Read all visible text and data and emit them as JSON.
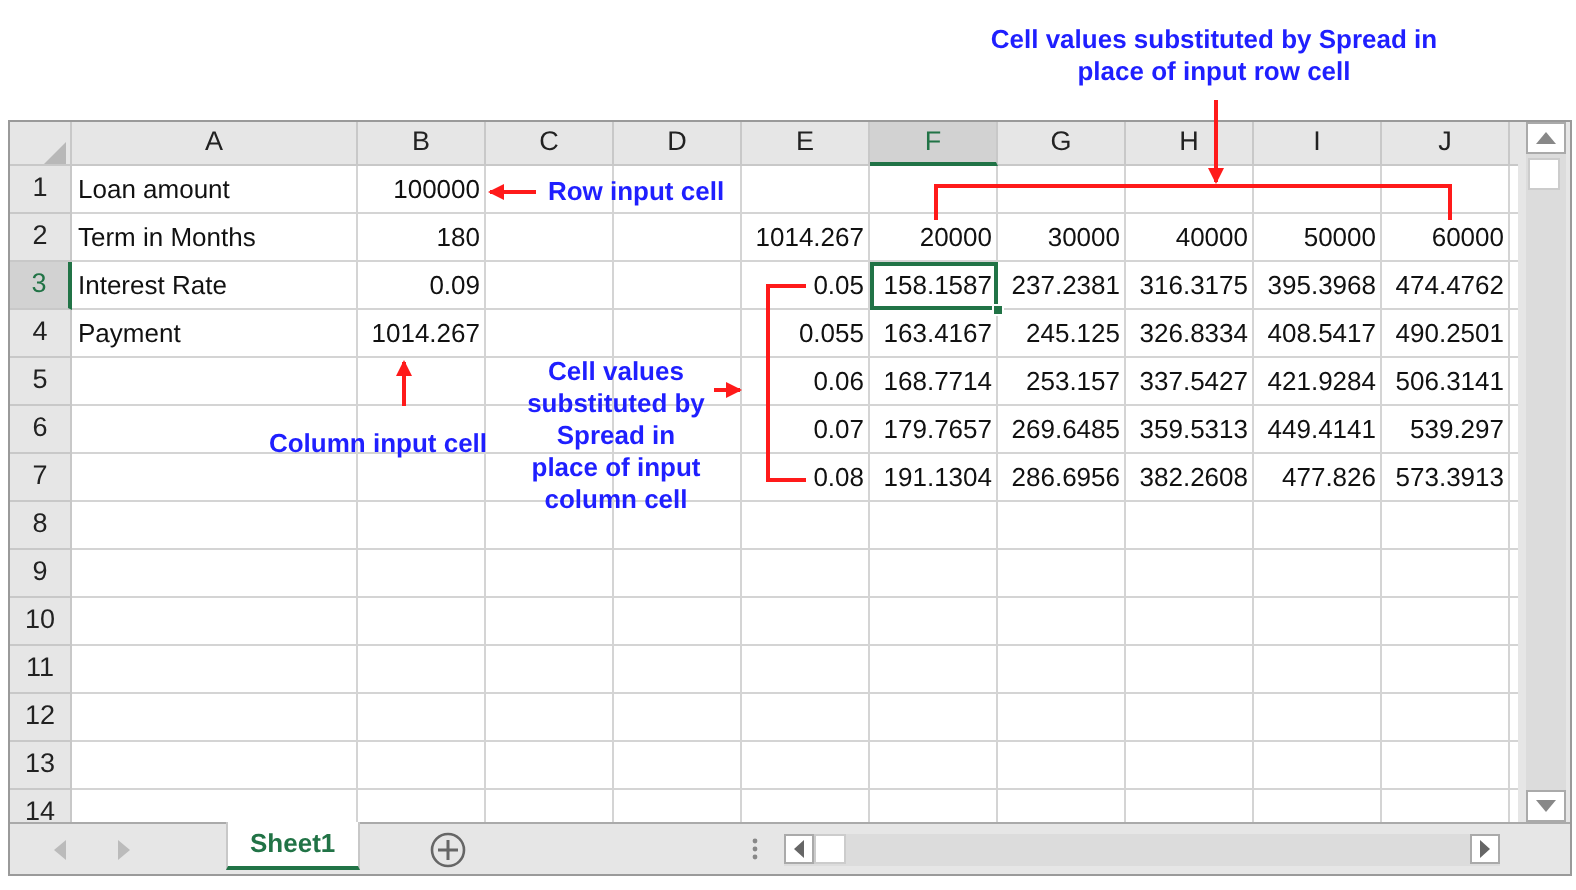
{
  "sheet": {
    "columns": [
      {
        "label": "A",
        "selected": false
      },
      {
        "label": "B",
        "selected": false
      },
      {
        "label": "C",
        "selected": false
      },
      {
        "label": "D",
        "selected": false
      },
      {
        "label": "E",
        "selected": false
      },
      {
        "label": "F",
        "selected": true
      },
      {
        "label": "G",
        "selected": false
      },
      {
        "label": "H",
        "selected": false
      },
      {
        "label": "I",
        "selected": false
      },
      {
        "label": "J",
        "selected": false
      }
    ],
    "rows": [
      {
        "label": "1",
        "selected": false,
        "cells": [
          "Loan amount",
          "100000"
        ]
      },
      {
        "label": "2",
        "selected": false,
        "cells": [
          "Term in Months",
          "180",
          null,
          null,
          "1014.267",
          "20000",
          "30000",
          "40000",
          "50000",
          "60000"
        ]
      },
      {
        "label": "3",
        "selected": true,
        "cells": [
          "Interest Rate",
          "0.09",
          null,
          null,
          "0.05",
          "158.1587",
          "237.2381",
          "316.3175",
          "395.3968",
          "474.4762"
        ]
      },
      {
        "label": "4",
        "selected": false,
        "cells": [
          "Payment",
          "1014.267",
          null,
          null,
          "0.055",
          "163.4167",
          "245.125",
          "326.8334",
          "408.5417",
          "490.2501"
        ]
      },
      {
        "label": "5",
        "selected": false,
        "cells": [
          null,
          null,
          null,
          null,
          "0.06",
          "168.7714",
          "253.157",
          "337.5427",
          "421.9284",
          "506.3141"
        ]
      },
      {
        "label": "6",
        "selected": false,
        "cells": [
          null,
          null,
          null,
          null,
          "0.07",
          "179.7657",
          "269.6485",
          "359.5313",
          "449.4141",
          "539.297"
        ]
      },
      {
        "label": "7",
        "selected": false,
        "cells": [
          null,
          null,
          null,
          null,
          "0.08",
          "191.1304",
          "286.6956",
          "382.2608",
          "477.826",
          "573.3913"
        ]
      },
      {
        "label": "8",
        "selected": false
      },
      {
        "label": "9",
        "selected": false
      },
      {
        "label": "10",
        "selected": false
      },
      {
        "label": "11",
        "selected": false
      },
      {
        "label": "12",
        "selected": false
      },
      {
        "label": "13",
        "selected": false
      },
      {
        "label": "14",
        "selected": false
      }
    ]
  },
  "sheet_tabs": [
    {
      "label": "Sheet1",
      "selected": true
    }
  ],
  "annotations": [
    {
      "kind": "row_values",
      "text": "Cell values substituted by Spread in place of input row cell"
    },
    {
      "kind": "row_input",
      "text": "Row input cell"
    },
    {
      "kind": "column_input",
      "text": "Column input cell"
    },
    {
      "kind": "column_values",
      "text": "Cell values substituted by Spread in place of input column cell"
    }
  ]
}
